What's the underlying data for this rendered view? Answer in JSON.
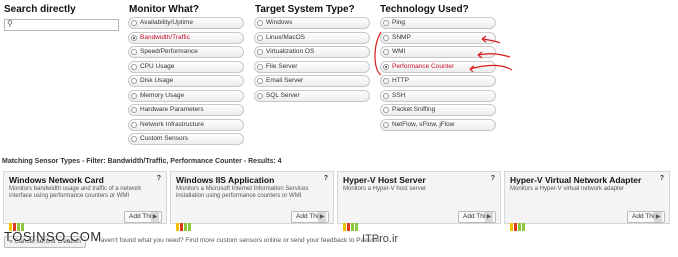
{
  "headers": {
    "search": "Search directly",
    "monitor": "Monitor What?",
    "target": "Target System Type?",
    "technology": "Technology Used?"
  },
  "search": {
    "value": "",
    "placeholder": ""
  },
  "monitor": [
    {
      "label": "Availability/Uptime",
      "selected": false
    },
    {
      "label": "Bandwidth/Traffic",
      "selected": true
    },
    {
      "label": "Speed/Performance",
      "selected": false
    },
    {
      "label": "CPU Usage",
      "selected": false
    },
    {
      "label": "Disk Usage",
      "selected": false
    },
    {
      "label": "Memory Usage",
      "selected": false
    },
    {
      "label": "Hardware Parameters",
      "selected": false
    },
    {
      "label": "Network Infrastructure",
      "selected": false
    },
    {
      "label": "Custom Sensors",
      "selected": false
    }
  ],
  "target": [
    {
      "label": "Windows",
      "selected": false
    },
    {
      "label": "Linux/MacOS",
      "selected": false
    },
    {
      "label": "Virtualization OS",
      "selected": false
    },
    {
      "label": "File Server",
      "selected": false
    },
    {
      "label": "Email Server",
      "selected": false
    },
    {
      "label": "SQL Server",
      "selected": false
    }
  ],
  "technology": [
    {
      "label": "Ping",
      "selected": false
    },
    {
      "label": "SNMP",
      "selected": false
    },
    {
      "label": "WMI",
      "selected": false
    },
    {
      "label": "Performance Counter",
      "selected": true
    },
    {
      "label": "HTTP",
      "selected": false
    },
    {
      "label": "SSH",
      "selected": false
    },
    {
      "label": "Packet Sniffing",
      "selected": false
    },
    {
      "label": "NetFlow, sFlow, jFlow",
      "selected": false
    }
  ],
  "results": {
    "title": "Matching Sensor Types - Filter: Bandwidth/Traffic, Performance Counter - Results: 4"
  },
  "cards": [
    {
      "title": "Windows Network Card",
      "help": "?",
      "desc": "Monitors bandwidth usage and traffic of a network interface using performance counters or WMI",
      "add_label": "Add This"
    },
    {
      "title": "Windows IIS Application",
      "help": "?",
      "desc": "Monitors a Microsoft Internet Information Services installation using performance counters or WMI",
      "add_label": "Add This"
    },
    {
      "title": "Hyper-V Host Server",
      "help": "?",
      "desc": "Monitors a Hyper-V host server",
      "add_label": "Add This"
    },
    {
      "title": "Hyper-V Virtual Network Adapter",
      "help": "?",
      "desc": "Monitors a Hyper-V virtual network adapter",
      "add_label": "Add This"
    }
  ],
  "footer": {
    "cancel_label": "« Cancel sensor creation",
    "text": "Haven't found what you need? Find more custom sensors online or send your feedback to Paessler"
  },
  "watermarks": {
    "left": "TOSINSO.COM",
    "right": "ITPro.ir"
  },
  "colors": {
    "selected_text": "#c8102e",
    "annotation": "#d81e1e",
    "bar_green": "#8dc63f",
    "bar_yellow": "#f2c500",
    "bar_red": "#e03a1e"
  }
}
